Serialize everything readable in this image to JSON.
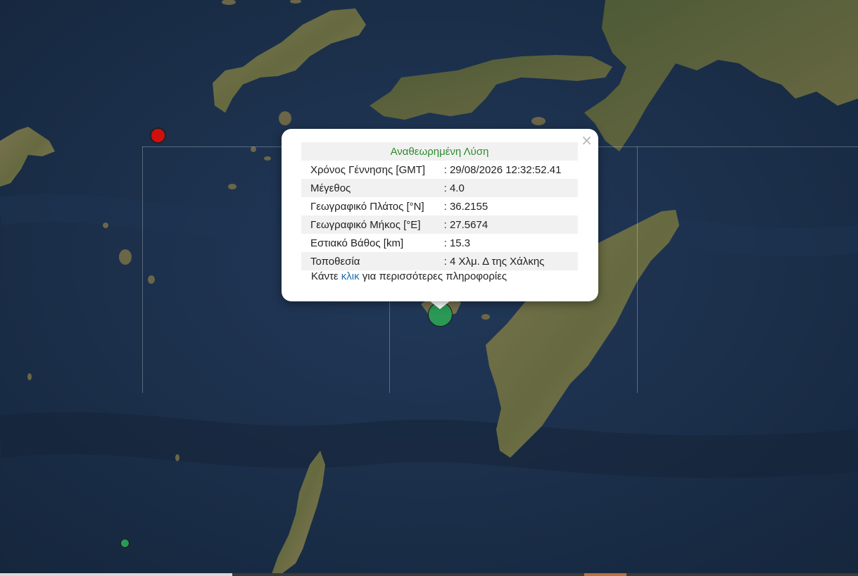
{
  "colors": {
    "sea": "#1b3048",
    "land": "#6f6a48",
    "marker_red": "#d10f0f",
    "marker_green": "#2a9955",
    "popup_title": "#2e8b2e",
    "link": "#1f6fae"
  },
  "map": {
    "markers": [
      {
        "id": "red-event",
        "color_name": "red"
      },
      {
        "id": "green-event-small",
        "color_name": "green"
      },
      {
        "id": "green-event-selected",
        "color_name": "green"
      }
    ]
  },
  "popup": {
    "close_label": "×",
    "title": "Αναθεωρημένη Λύση",
    "rows": [
      {
        "label": "Χρόνος Γέννησης [GMT]",
        "value": ": 29/08/2026 12:32:52.41"
      },
      {
        "label": "Μέγεθος",
        "value": ": 4.0"
      },
      {
        "label": "Γεωγραφικό Πλάτος [°N]",
        "value": ": 36.2155"
      },
      {
        "label": "Γεωγραφικό Μήκος [°E]",
        "value": ": 27.5674"
      },
      {
        "label": "Εστιακό Βάθος [km]",
        "value": ": 15.3"
      },
      {
        "label": "Τοποθεσία",
        "value": ": 4 Χλμ. Δ της Χάλκης"
      }
    ],
    "more": {
      "prefix": "Κάντε ",
      "link": "κλικ",
      "suffix": " για περισσότερες πληροφορίες"
    }
  }
}
